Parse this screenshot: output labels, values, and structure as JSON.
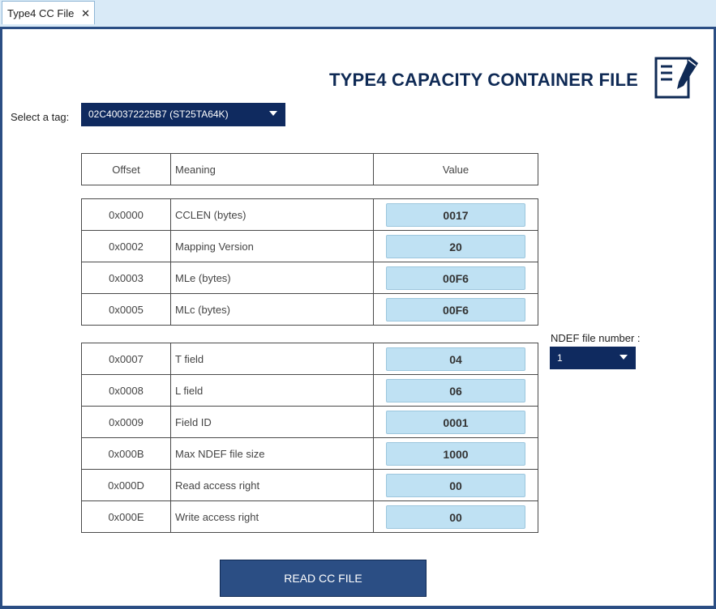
{
  "tab": {
    "label": "Type4 CC File",
    "close": "✕"
  },
  "title": "TYPE4 CAPACITY CONTAINER FILE",
  "tag_select": {
    "label": "Select a tag:",
    "value": "02C400372225B7 (ST25TA64K)"
  },
  "ndef_select": {
    "label": "NDEF file number :",
    "value": "1"
  },
  "table": {
    "headers": {
      "offset": "Offset",
      "meaning": "Meaning",
      "value": "Value"
    },
    "group1": [
      {
        "offset": "0x0000",
        "meaning": "CCLEN (bytes)",
        "value": "0017"
      },
      {
        "offset": "0x0002",
        "meaning": "Mapping Version",
        "value": "20"
      },
      {
        "offset": "0x0003",
        "meaning": "MLe (bytes)",
        "value": "00F6"
      },
      {
        "offset": "0x0005",
        "meaning": "MLc (bytes)",
        "value": "00F6"
      }
    ],
    "group2": [
      {
        "offset": "0x0007",
        "meaning": "T field",
        "value": "04"
      },
      {
        "offset": "0x0008",
        "meaning": "L field",
        "value": "06"
      },
      {
        "offset": "0x0009",
        "meaning": "Field ID",
        "value": "0001"
      },
      {
        "offset": "0x000B",
        "meaning": "Max NDEF file size",
        "value": "1000"
      },
      {
        "offset": "0x000D",
        "meaning": "Read access right",
        "value": "00"
      },
      {
        "offset": "0x000E",
        "meaning": "Write access right",
        "value": "00"
      }
    ]
  },
  "read_button": {
    "label": "READ CC FILE"
  },
  "icons": {
    "document": "document-edit-icon",
    "close": "close-icon",
    "dropdown": "chevron-down-icon"
  },
  "colors": {
    "accent": "#2b4e84",
    "dark_blue": "#0f2a5f",
    "value_bg": "#bfe1f3",
    "tab_bar": "#d9eaf7"
  }
}
